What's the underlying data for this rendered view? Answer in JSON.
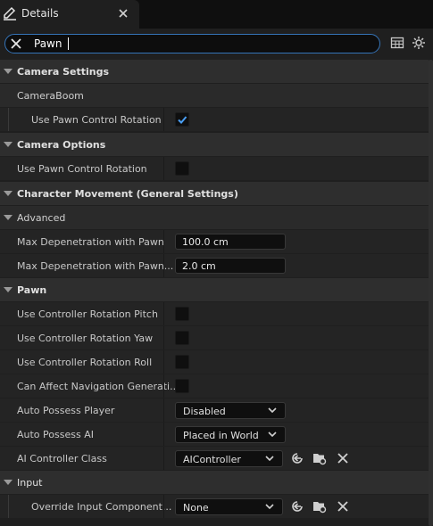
{
  "tab": {
    "title": "Details"
  },
  "search": {
    "value": "Pawn"
  },
  "sections": {
    "camera_settings": "Camera Settings",
    "camera_boom": "CameraBoom",
    "camera_options": "Camera Options",
    "character_movement": "Character Movement (General Settings)",
    "advanced": "Advanced",
    "pawn": "Pawn",
    "input": "Input"
  },
  "properties": {
    "use_pawn_control_rotation_boom": {
      "label": "Use Pawn Control Rotation",
      "checked": true
    },
    "use_pawn_control_rotation_camera": {
      "label": "Use Pawn Control Rotation",
      "checked": false
    },
    "max_depenetration_pawn": {
      "label": "Max Depenetration with Pawn",
      "value": "100.0 cm"
    },
    "max_depenetration_pawn_2": {
      "label": "Max Depenetration with Pawn...",
      "value": "2.0 cm"
    },
    "use_controller_rotation_pitch": {
      "label": "Use Controller Rotation Pitch",
      "checked": false
    },
    "use_controller_rotation_yaw": {
      "label": "Use Controller Rotation Yaw",
      "checked": false
    },
    "use_controller_rotation_roll": {
      "label": "Use Controller Rotation Roll",
      "checked": false
    },
    "can_affect_navigation": {
      "label": "Can Affect Navigation Generati...",
      "checked": false
    },
    "auto_possess_player": {
      "label": "Auto Possess Player",
      "value": "Disabled"
    },
    "auto_possess_ai": {
      "label": "Auto Possess AI",
      "value": "Placed in World"
    },
    "ai_controller_class": {
      "label": "AI Controller Class",
      "value": "AIController"
    },
    "override_input_component": {
      "label": "Override Input Component...",
      "value": "None"
    }
  },
  "colors": {
    "accent": "#3574b8",
    "check": "#4a9ff5"
  },
  "icons": [
    "pencil-icon",
    "close-icon",
    "clear-search-icon",
    "table-view-icon",
    "settings-gear-icon",
    "chevron-down-icon",
    "checkmark-icon",
    "use-selected-arrow-icon",
    "browse-folder-icon",
    "clear-x-icon"
  ]
}
